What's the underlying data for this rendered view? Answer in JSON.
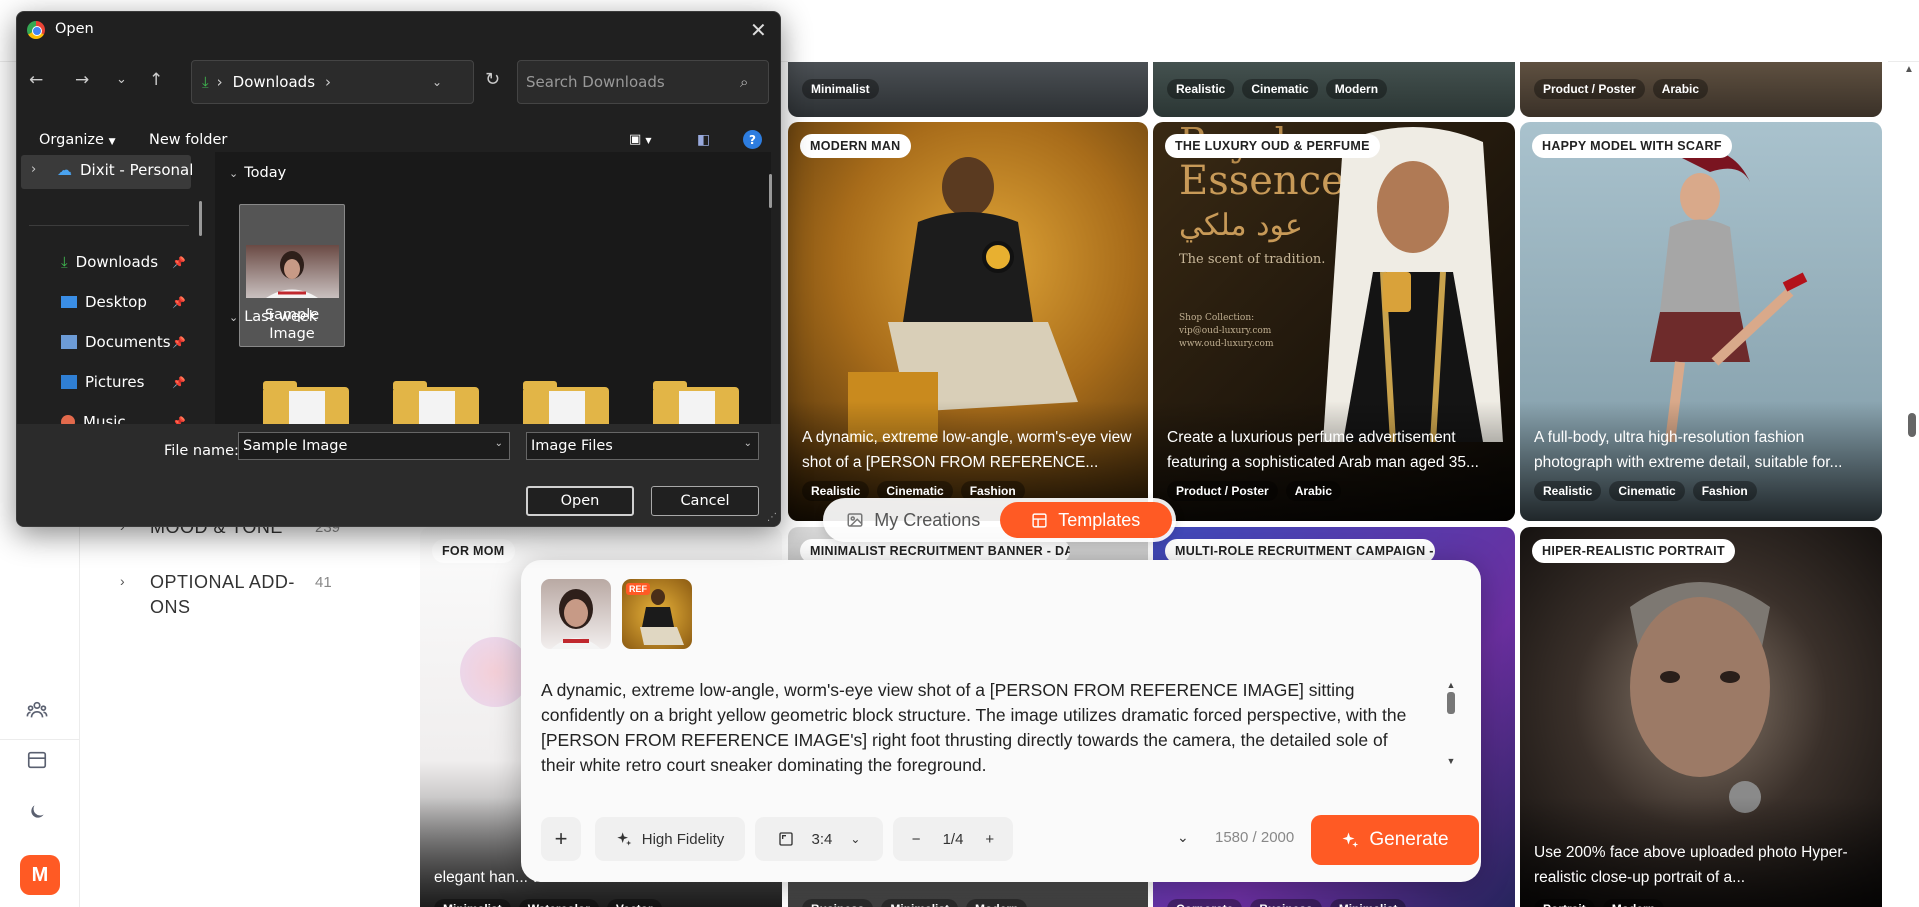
{
  "colors": {
    "accent": "#ff5a24",
    "dialog_bg": "#202020"
  },
  "left_rail": {
    "icons": [
      "team-icon",
      "card-icon",
      "moon-icon"
    ],
    "avatar_initial": "M"
  },
  "categories": [
    {
      "label": "MOOD & TONE",
      "count": "239"
    },
    {
      "label": "OPTIONAL ADD-ONS",
      "count": "41"
    }
  ],
  "top_row_tags": [
    [
      "Minimalist"
    ],
    [
      "Realistic",
      "Cinematic",
      "Modern"
    ],
    [
      "Product / Poster",
      "Arabic"
    ]
  ],
  "cards": [
    {
      "title": "MODERN MAN",
      "description": "A dynamic, extreme low-angle, worm's-eye view shot of a [PERSON FROM REFERENCE...",
      "tags": [
        "Realistic",
        "Cinematic",
        "Fashion"
      ]
    },
    {
      "title": "THE LUXURY OUD & PERFUME",
      "description": "Create a luxurious perfume advertisement featuring a sophisticated Arab man aged 35...",
      "tags": [
        "Product / Poster",
        "Arabic"
      ],
      "poster_line1": "Royal",
      "poster_line2": "Essence",
      "poster_arabic": "عود ملكي",
      "poster_tagline": "The scent of tradition.",
      "poster_shop": "Shop Collection:",
      "poster_email": "vip@oud-luxury.com",
      "poster_site": "www.oud-luxury.com"
    },
    {
      "title": "HAPPY MODEL WITH SCARF",
      "description": "A full-body, ultra high-resolution fashion photograph with extreme detail, suitable for...",
      "tags": [
        "Realistic",
        "Cinematic",
        "Fashion"
      ]
    },
    {
      "title": "FOR MOM",
      "description": "elegant han... with soft wa...",
      "tags": [
        "Minimalist",
        "Watercolor",
        "Vector"
      ]
    },
    {
      "title": "MINIMALIST RECRUITMENT BANNER - DATA ANALY",
      "tags": [
        "Business",
        "Minimalist",
        "Modern"
      ]
    },
    {
      "title": "MULTI-ROLE RECRUITMENT CAMPAIGN - JOIN OUR",
      "tags": [
        "Corporate",
        "Business",
        "Minimalist"
      ]
    },
    {
      "title": "HIPER-REALISTIC PORTRAIT",
      "description": "Use 200% face above uploaded photo Hyper-realistic close-up portrait of a...",
      "tags": [
        "Portrait",
        "Modern"
      ]
    }
  ],
  "toggle": {
    "my_creations": "My Creations",
    "templates": "Templates"
  },
  "composer": {
    "ref_badge": "REF",
    "prompt": "A dynamic, extreme low-angle, worm's-eye view shot of a [PERSON FROM REFERENCE IMAGE] sitting confidently on a bright yellow geometric block structure. The image utilizes dramatic forced perspective, with the [PERSON FROM REFERENCE IMAGE's] right foot thrusting directly towards the camera, the detailed sole of their white retro court sneaker dominating the foreground.",
    "add": "+",
    "fidelity": "High Fidelity",
    "aspect": "3:4",
    "count": "1/4",
    "char_count": "1580 / 2000",
    "generate": "Generate"
  },
  "dialog": {
    "title": "Open",
    "location": "Downloads",
    "search_placeholder": "Search Downloads",
    "organize": "Organize",
    "new_folder": "New folder",
    "nav_items": [
      {
        "label": "Dixit - Personal"
      },
      {
        "label": "Downloads"
      },
      {
        "label": "Desktop"
      },
      {
        "label": "Documents"
      },
      {
        "label": "Pictures"
      },
      {
        "label": "Music"
      }
    ],
    "group_today": "Today",
    "group_last_week": "Last week",
    "file_name_line1": "Sample",
    "file_name_line2": "Image",
    "file_name_label": "File name:",
    "file_name_value": "Sample Image",
    "file_type": "Image Files",
    "open_button": "Open",
    "cancel_button": "Cancel"
  }
}
